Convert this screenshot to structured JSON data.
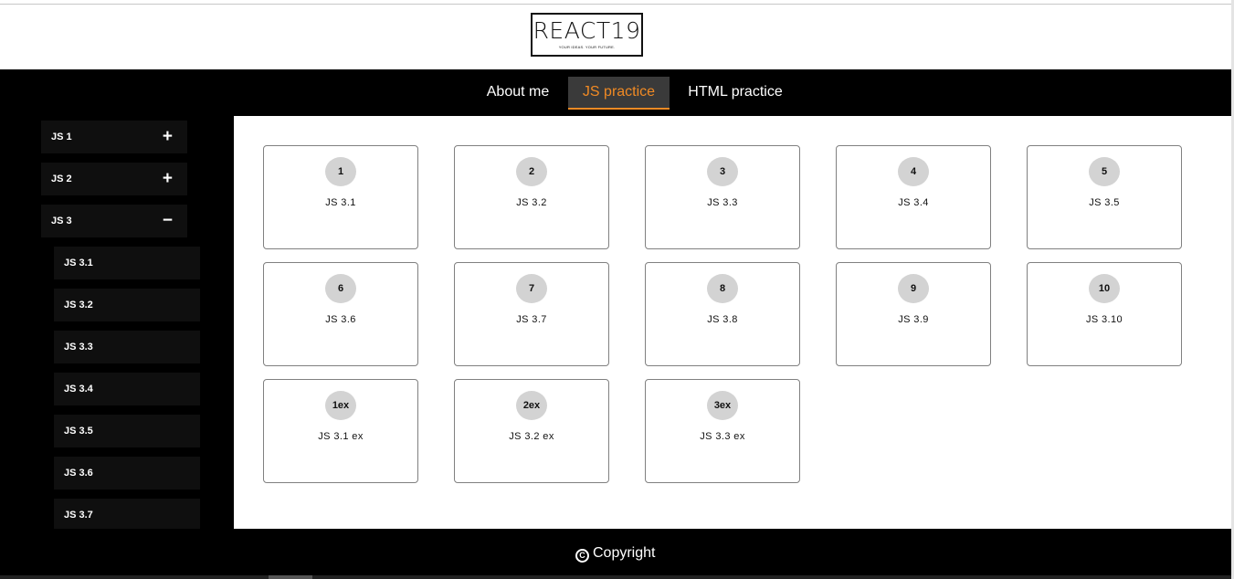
{
  "header": {
    "logo_title": "REACT19",
    "logo_tagline": "YOUR IDEAS. YOUR FUTURE."
  },
  "nav": {
    "items": [
      {
        "label": "About me",
        "active": false
      },
      {
        "label": "JS practice",
        "active": true
      },
      {
        "label": "HTML practice",
        "active": false
      }
    ],
    "active_color": "#f08a24"
  },
  "sidebar": {
    "groups": [
      {
        "label": "JS 1",
        "sign": "+"
      },
      {
        "label": "JS 2",
        "sign": "+"
      },
      {
        "label": "JS 3",
        "sign": "−"
      }
    ],
    "sub_items": [
      "JS 3.1",
      "JS 3.2",
      "JS 3.3",
      "JS 3.4",
      "JS 3.5",
      "JS 3.6",
      "JS 3.7"
    ]
  },
  "cards": [
    {
      "num": "1",
      "caption": "JS 3.1"
    },
    {
      "num": "2",
      "caption": "JS 3.2"
    },
    {
      "num": "3",
      "caption": "JS 3.3"
    },
    {
      "num": "4",
      "caption": "JS 3.4"
    },
    {
      "num": "5",
      "caption": "JS 3.5"
    },
    {
      "num": "6",
      "caption": "JS 3.6"
    },
    {
      "num": "7",
      "caption": "JS 3.7"
    },
    {
      "num": "8",
      "caption": "JS 3.8"
    },
    {
      "num": "9",
      "caption": "JS 3.9"
    },
    {
      "num": "10",
      "caption": "JS 3.10"
    },
    {
      "num": "1ex",
      "caption": "JS 3.1 ex"
    },
    {
      "num": "2ex",
      "caption": "JS 3.2 ex"
    },
    {
      "num": "3ex",
      "caption": "JS 3.3 ex"
    }
  ],
  "footer": {
    "copyright_symbol": "C",
    "copyright_text": "Copyright"
  }
}
